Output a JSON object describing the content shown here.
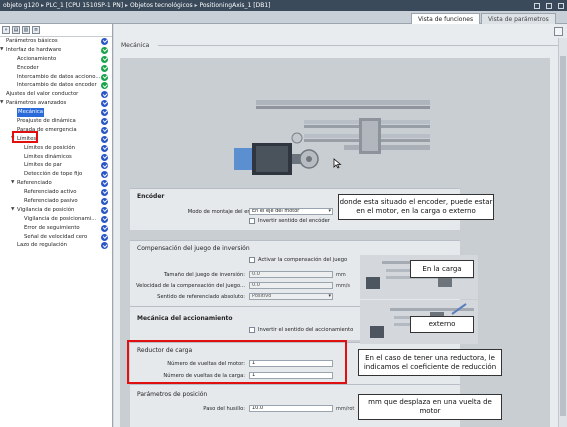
{
  "titlebar": {
    "crumbs": [
      "objeto g120",
      "PLC_1 [CPU 1510SP-1 PN]",
      "Objetos tecnológicos",
      "PositioningAxis_1 [DB1]"
    ]
  },
  "top_tabs": {
    "func": "Vista de funciones",
    "param": "Vista de parámetros"
  },
  "nav": [
    {
      "label": "Parámetros básicos",
      "level": 0,
      "arrow": "",
      "check": "blue"
    },
    {
      "label": "Interfaz de hardware",
      "level": 0,
      "arrow": "▼",
      "check": "green"
    },
    {
      "label": "Accionamiento",
      "level": 1,
      "arrow": "",
      "check": "green"
    },
    {
      "label": "Encoder",
      "level": 1,
      "arrow": "",
      "check": "green"
    },
    {
      "label": "Intercambio de datos acciono...",
      "level": 1,
      "arrow": "",
      "check": "green"
    },
    {
      "label": "Intercambio de datos encoder",
      "level": 1,
      "arrow": "",
      "check": "green"
    },
    {
      "label": "Ajustes del valor conductor",
      "level": 0,
      "arrow": "",
      "check": "blue"
    },
    {
      "label": "Parámetros avanzados",
      "level": 0,
      "arrow": "▼",
      "check": "blue"
    },
    {
      "label": "Mecánica",
      "level": 1,
      "arrow": "",
      "check": "blue",
      "selected": true
    },
    {
      "label": "Preajuste de dinámica",
      "level": 1,
      "arrow": "",
      "check": "blue"
    },
    {
      "label": "Parada de emergencia",
      "level": 1,
      "arrow": "",
      "check": "blue"
    },
    {
      "label": "Límites",
      "level": 1,
      "arrow": "▼",
      "check": "blue"
    },
    {
      "label": "Límites de posición",
      "level": 2,
      "arrow": "",
      "check": "blue"
    },
    {
      "label": "Límites dinámicos",
      "level": 2,
      "arrow": "",
      "check": "blue"
    },
    {
      "label": "Límites de par",
      "level": 2,
      "arrow": "",
      "check": "blue"
    },
    {
      "label": "Detección de tope fijo",
      "level": 2,
      "arrow": "",
      "check": "blue"
    },
    {
      "label": "Referenciado",
      "level": 1,
      "arrow": "▼",
      "check": "blue"
    },
    {
      "label": "Referenciado activo",
      "level": 2,
      "arrow": "",
      "check": "blue"
    },
    {
      "label": "Referenciado pasivo",
      "level": 2,
      "arrow": "",
      "check": "blue"
    },
    {
      "label": "Vigilancia de posición",
      "level": 1,
      "arrow": "▼",
      "check": "blue"
    },
    {
      "label": "Vigilancia de posicionami...",
      "level": 2,
      "arrow": "",
      "check": "blue"
    },
    {
      "label": "Error de seguimiento",
      "level": 2,
      "arrow": "",
      "check": "blue"
    },
    {
      "label": "Señal de velocidad cero",
      "level": 2,
      "arrow": "",
      "check": "blue"
    },
    {
      "label": "Lazo de regulación",
      "level": 1,
      "arrow": "",
      "check": "blue"
    }
  ],
  "main": {
    "section_title": "Mecánica",
    "encoder": {
      "title": "Encóder",
      "mount_label": "Modo de montaje del encóder:",
      "mount_value": "En el eje del motor",
      "invert_label": "Invertir sentido del encóder"
    },
    "backlash": {
      "title": "Compensación del juego de inversión",
      "activate_label": "Activar la compensación del juego",
      "size_label": "Tamaño del juego de inversión:",
      "size_value": "0.0",
      "size_unit": "mm",
      "speed_label": "Velocidad de la compensación del juego...",
      "speed_value": "0.0",
      "speed_unit": "mm/s",
      "dir_label": "Sentido de referenciado absoluto:",
      "dir_value": "Positivo"
    },
    "drive_mech": {
      "title": "Mecánica del accionamiento",
      "invert_label": "Invertir el sentido del accionamiento"
    },
    "gear": {
      "title": "Reductor de carga",
      "motor_label": "Número de vueltas del motor:",
      "motor_value": "1",
      "load_label": "Número de vueltas de la carga:",
      "load_value": "1"
    },
    "position": {
      "title": "Parámetros de posición",
      "pitch_label": "Paso del husillo:",
      "pitch_value": "10.0",
      "pitch_unit": "mm/rot"
    }
  },
  "notes": {
    "encoder": "donde esta situado el encoder, puede estar en el motor, en la carga o externo",
    "load": "En la carga",
    "external": "externo",
    "gear": "En el caso de tener una reductora, le indicamos el coeficiente de reducción",
    "pitch": "mm que desplaza en una vuelta de motor"
  }
}
